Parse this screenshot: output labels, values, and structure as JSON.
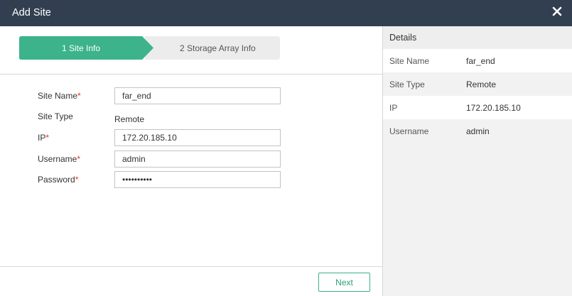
{
  "dialog": {
    "title": "Add Site",
    "close_icon": "close-icon"
  },
  "steps": [
    {
      "label": "1 Site Info",
      "active": true
    },
    {
      "label": "2 Storage Array Info",
      "active": false
    }
  ],
  "form": {
    "site_name": {
      "label": "Site Name",
      "required": "*",
      "value": "far_end"
    },
    "site_type": {
      "label": "Site Type",
      "value": "Remote"
    },
    "ip": {
      "label": "IP",
      "required": "*",
      "value": "172.20.185.10"
    },
    "username": {
      "label": "Username",
      "required": "*",
      "value": "admin"
    },
    "password": {
      "label": "Password",
      "required": "*",
      "value": "••••••••••"
    }
  },
  "buttons": {
    "next": "Next"
  },
  "details": {
    "title": "Details",
    "rows": [
      {
        "key": "Site Name",
        "value": "far_end"
      },
      {
        "key": "Site Type",
        "value": "Remote"
      },
      {
        "key": "IP",
        "value": "172.20.185.10"
      },
      {
        "key": "Username",
        "value": "admin"
      }
    ]
  },
  "colors": {
    "titlebar": "#323f51",
    "step_active": "#3cb38a",
    "step_inactive": "#ececec",
    "required": "#e0332f",
    "next_button": "#2aa176"
  }
}
